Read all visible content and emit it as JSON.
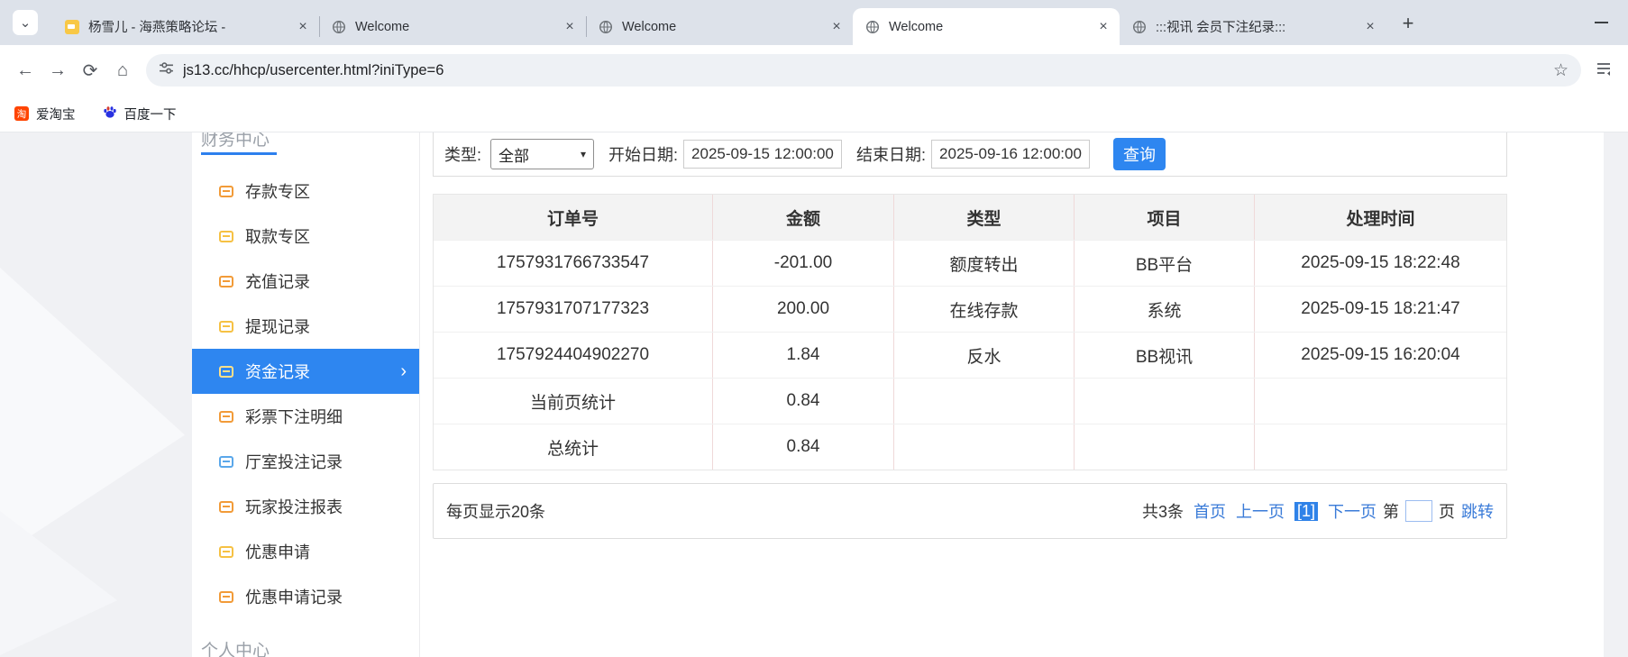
{
  "browser": {
    "tabs": [
      {
        "title": "杨雪儿 - 海燕策略论坛 -",
        "favicon": "forum-icon",
        "active": false
      },
      {
        "title": "Welcome",
        "favicon": "globe-icon",
        "active": false
      },
      {
        "title": "Welcome",
        "favicon": "globe-icon",
        "active": false
      },
      {
        "title": "Welcome",
        "favicon": "globe-icon",
        "active": true
      },
      {
        "title": ":::视讯 会员下注纪录:::",
        "favicon": "globe-icon",
        "active": false
      }
    ],
    "url": "js13.cc/hhcp/usercenter.html?iniType=6",
    "bookmarks": [
      {
        "label": "爱淘宝",
        "icon": "taobao-icon"
      },
      {
        "label": "百度一下",
        "icon": "baidu-icon"
      }
    ]
  },
  "glyphs": {
    "tab_search": "⌄",
    "new_tab": "+",
    "back": "←",
    "forward": "→",
    "reload": "⟳",
    "home": "⌂",
    "star": "☆",
    "active_chevron": "›",
    "select_arrow": "▾",
    "taobao_char": "淘"
  },
  "sidebar": {
    "section_top": "财务中心",
    "items": [
      {
        "label": "存款专区",
        "icon": "deposit-icon",
        "active": false
      },
      {
        "label": "取款专区",
        "icon": "withdraw-area-icon",
        "active": false
      },
      {
        "label": "充值记录",
        "icon": "recharge-record-icon",
        "active": false
      },
      {
        "label": "提现记录",
        "icon": "withdrawal-record-icon",
        "active": false
      },
      {
        "label": "资金记录",
        "icon": "funds-record-icon",
        "active": true
      },
      {
        "label": "彩票下注明细",
        "icon": "lottery-bet-detail-icon",
        "active": false
      },
      {
        "label": "厅室投注记录",
        "icon": "room-bet-record-icon",
        "active": false
      },
      {
        "label": "玩家投注报表",
        "icon": "player-bet-report-icon",
        "active": false
      },
      {
        "label": "优惠申请",
        "icon": "promo-apply-icon",
        "active": false
      },
      {
        "label": "优惠申请记录",
        "icon": "promo-apply-record-icon",
        "active": false
      }
    ],
    "section_bottom": "个人中心"
  },
  "filter": {
    "type_label": "类型:",
    "type_value": "全部",
    "start_label": "开始日期:",
    "start_value": "2025-09-15 12:00:00",
    "end_label": "结束日期:",
    "end_value": "2025-09-16 12:00:00",
    "search_label": "查询"
  },
  "table": {
    "headers": [
      "订单号",
      "金额",
      "类型",
      "项目",
      "处理时间"
    ],
    "rows": [
      [
        "1757931766733547",
        "-201.00",
        "额度转出",
        "BB平台",
        "2025-09-15 18:22:48"
      ],
      [
        "1757931707177323",
        "200.00",
        "在线存款",
        "系统",
        "2025-09-15 18:21:47"
      ],
      [
        "1757924404902270",
        "1.84",
        "反水",
        "BB视讯",
        "2025-09-15 16:20:04"
      ],
      [
        "当前页统计",
        "0.84",
        "",
        "",
        ""
      ],
      [
        "总统计",
        "0.84",
        "",
        "",
        ""
      ]
    ]
  },
  "pagination": {
    "per_page_text": "每页显示20条",
    "total_text": "共3条",
    "first": "首页",
    "prev": "上一页",
    "current": "[1]",
    "next": "下一页",
    "jump_prefix": "第",
    "jump_suffix": "页",
    "jump_action": "跳转",
    "page_input_value": ""
  },
  "colors": {
    "accent_blue": "#2e86f0",
    "link_blue": "#3a7bd8",
    "tab_strip_bg": "#dde2ea",
    "sidebar_icon_orange": "#f29b38",
    "sidebar_icon_yellow": "#f6c143",
    "table_header_bg": "#f3f3f3"
  }
}
